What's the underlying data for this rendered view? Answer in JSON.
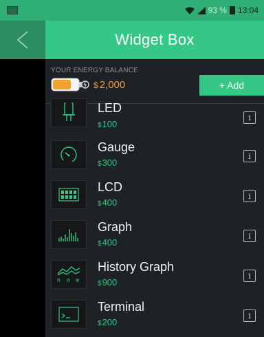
{
  "status_bar": {
    "battery_percent": "93 %",
    "time": "13:04"
  },
  "app_bar": {
    "title": "Widget Box"
  },
  "energy": {
    "label": "YOUR ENERGY BALANCE",
    "currency_symbol": "$",
    "value": "2,000",
    "add_label": "+ Add"
  },
  "widgets": [
    {
      "name": "LED",
      "currency_symbol": "$",
      "price": "100",
      "icon": "led-icon",
      "info": "i"
    },
    {
      "name": "Gauge",
      "currency_symbol": "$",
      "price": "300",
      "icon": "gauge-icon",
      "info": "i"
    },
    {
      "name": "LCD",
      "currency_symbol": "$",
      "price": "400",
      "icon": "lcd-icon",
      "info": "i"
    },
    {
      "name": "Graph",
      "currency_symbol": "$",
      "price": "400",
      "icon": "graph-icon",
      "info": "i"
    },
    {
      "name": "History Graph",
      "currency_symbol": "$",
      "price": "900",
      "icon": "history-graph-icon",
      "icon_text": "h d m",
      "info": "i"
    },
    {
      "name": "Terminal",
      "currency_symbol": "$",
      "price": "200",
      "icon": "terminal-icon",
      "info": "i"
    }
  ],
  "colors": {
    "accent": "#35c786",
    "status_bar": "#2fae76",
    "back_button": "#2b8d60",
    "panel": "#1e2126",
    "energy": "#f0a13b"
  }
}
